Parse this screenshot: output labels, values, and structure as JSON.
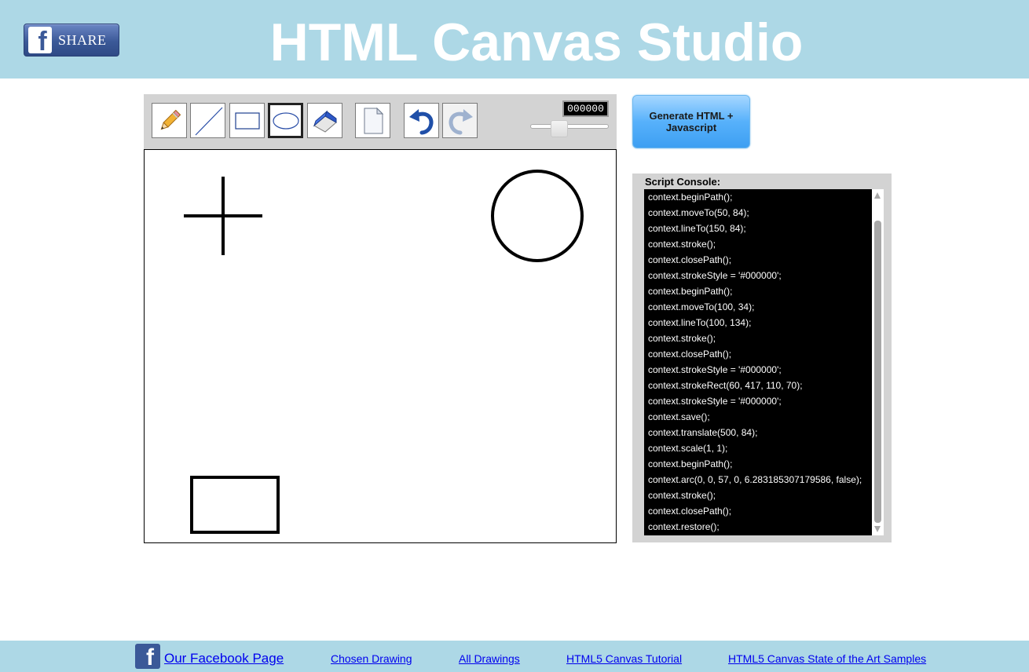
{
  "header": {
    "share_label": "SHARE",
    "title": "HTML Canvas Studio"
  },
  "toolbar": {
    "tools": [
      {
        "id": "pencil",
        "icon": "pencil-icon",
        "selected": false
      },
      {
        "id": "line",
        "icon": "line-icon",
        "selected": false
      },
      {
        "id": "rectangle",
        "icon": "rectangle-icon",
        "selected": false
      },
      {
        "id": "ellipse",
        "icon": "ellipse-icon",
        "selected": true
      },
      {
        "id": "eraser",
        "icon": "eraser-icon",
        "selected": false
      },
      {
        "id": "new-page",
        "icon": "page-icon",
        "selected": false
      },
      {
        "id": "undo",
        "icon": "undo-icon",
        "selected": false
      },
      {
        "id": "redo",
        "icon": "redo-icon",
        "selected": false,
        "disabled": true
      }
    ],
    "color_value": "000000",
    "line_width_level": 0.33
  },
  "generate_button": {
    "label": "Generate HTML + Javascript"
  },
  "console": {
    "label": "Script Console:",
    "lines": [
      "context.beginPath();",
      "context.moveTo(50, 84);",
      "context.lineTo(150, 84);",
      "context.stroke();",
      "context.closePath();",
      "context.strokeStyle = '#000000';",
      "context.beginPath();",
      "context.moveTo(100, 34);",
      "context.lineTo(100, 134);",
      "context.stroke();",
      "context.closePath();",
      "context.strokeStyle = '#000000';",
      "context.strokeRect(60, 417, 110, 70);",
      "context.strokeStyle = '#000000';",
      "context.save();",
      "context.translate(500, 84);",
      "context.scale(1, 1);",
      "context.beginPath();",
      "context.arc(0, 0, 57, 0, 6.283185307179586, false);",
      "context.stroke();",
      "context.closePath();",
      "context.restore();"
    ]
  },
  "footer": {
    "links": [
      {
        "id": "facebook-page",
        "label": "Our Facebook Page"
      },
      {
        "id": "chosen-drawing",
        "label": "Chosen Drawing"
      },
      {
        "id": "all-drawings",
        "label": "All Drawings"
      },
      {
        "id": "canvas-tutorial",
        "label": "HTML5 Canvas Tutorial"
      },
      {
        "id": "state-of-art",
        "label": "HTML5 Canvas State of the Art Samples"
      }
    ]
  },
  "colors": {
    "header_bg": "#add8e6",
    "toolbar_bg": "#d3d3d3",
    "console_bg": "#000000",
    "link": "#0000ee",
    "facebook": "#3b5998"
  }
}
